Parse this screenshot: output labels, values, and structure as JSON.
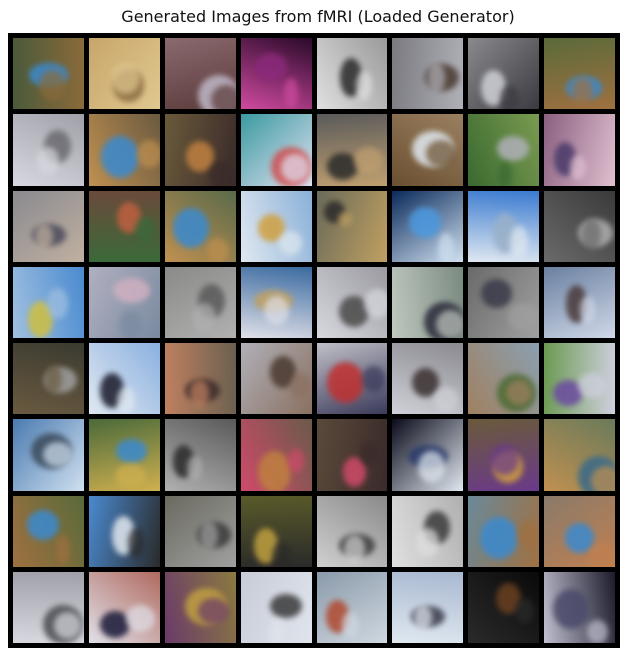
{
  "figure": {
    "title": "Generated Images from fMRI (Loaded Generator)"
  },
  "grid": {
    "rows": 8,
    "cols": 8,
    "frame_color": "#000000",
    "tiles": [
      {
        "base": "#4a5a3a",
        "accent": "#3a8ad0",
        "accent2": "#8a6a3a"
      },
      {
        "base": "#c8a66a",
        "accent": "#8a6a40",
        "accent2": "#e0c890"
      },
      {
        "base": "#8a6a6e",
        "accent": "#c0b8c8",
        "accent2": "#5a3a3a"
      },
      {
        "base": "#2a0a2a",
        "accent": "#8a2a7a",
        "accent2": "#d04aa0"
      },
      {
        "base": "#9a9a9a",
        "accent": "#2a2a2a",
        "accent2": "#e0e0e0"
      },
      {
        "base": "#7a7a80",
        "accent": "#4a3a30",
        "accent2": "#b0b0b8"
      },
      {
        "base": "#8a8a8e",
        "accent": "#d0d0d8",
        "accent2": "#3a3a40"
      },
      {
        "base": "#5a6a3a",
        "accent": "#3a8ad0",
        "accent2": "#a07040"
      },
      {
        "base": "#a0a0a8",
        "accent": "#6a6a70",
        "accent2": "#d8d8e0"
      },
      {
        "base": "#6a5a40",
        "accent": "#3a8ad0",
        "accent2": "#c09050"
      },
      {
        "base": "#6a5a3a",
        "accent": "#c08040",
        "accent2": "#3a2a2a"
      },
      {
        "base": "#3a9aa0",
        "accent": "#d05050",
        "accent2": "#e0e0f0"
      },
      {
        "base": "#5a5a5a",
        "accent": "#2a2a2a",
        "accent2": "#c0a070"
      },
      {
        "base": "#9a8060",
        "accent": "#e0e8f0",
        "accent2": "#6a5030"
      },
      {
        "base": "#7a9a50",
        "accent": "#b0b0b8",
        "accent2": "#3a6a30"
      },
      {
        "base": "#8a6080",
        "accent": "#4a3a6a",
        "accent2": "#e0c0d0"
      },
      {
        "base": "#8a8a90",
        "accent": "#4a4a5a",
        "accent2": "#c0b0a0"
      },
      {
        "base": "#6a4a3a",
        "accent": "#c06040",
        "accent2": "#3a6a3a"
      },
      {
        "base": "#5a6a4a",
        "accent": "#3a8ad0",
        "accent2": "#c09050"
      },
      {
        "base": "#8ab0d8",
        "accent": "#d0a040",
        "accent2": "#e0e8f0"
      },
      {
        "base": "#6a6a5a",
        "accent": "#2a2a2a",
        "accent2": "#c0a060"
      },
      {
        "base": "#0a2a5a",
        "accent": "#4a9ae0",
        "accent2": "#d0e0f0"
      },
      {
        "base": "#3a7ad0",
        "accent": "#9ab0c8",
        "accent2": "#e0e8f0"
      },
      {
        "base": "#3a3a3a",
        "accent": "#b0b0b0",
        "accent2": "#6a6a6a"
      },
      {
        "base": "#4a8ad0",
        "accent": "#d0c040",
        "accent2": "#a0c0e0"
      },
      {
        "base": "#b0b0c0",
        "accent": "#d0b0c0",
        "accent2": "#7a8aa0"
      },
      {
        "base": "#8a8a88",
        "accent": "#5a5a5a",
        "accent2": "#b0b0b0"
      },
      {
        "base": "#3a6aa0",
        "accent": "#c0a060",
        "accent2": "#e0e0e8"
      },
      {
        "base": "#9a9aa0",
        "accent": "#4a4a4a",
        "accent2": "#d8d8e0"
      },
      {
        "base": "#7a8a80",
        "accent": "#2a2a3a",
        "accent2": "#c0c8c0"
      },
      {
        "base": "#6a6a6a",
        "accent": "#3a3a4a",
        "accent2": "#a0a0a0"
      },
      {
        "base": "#6a80a0",
        "accent": "#4a3a3a",
        "accent2": "#d0d8e8"
      },
      {
        "base": "#3a3a30",
        "accent": "#a0a0a0",
        "accent2": "#6a5a40"
      },
      {
        "base": "#8ab0e0",
        "accent": "#1a1a2a",
        "accent2": "#e0e8f0"
      },
      {
        "base": "#6a6050",
        "accent": "#3a2a2a",
        "accent2": "#c08060"
      },
      {
        "base": "#b0b0b8",
        "accent": "#4a3a30",
        "accent2": "#8a7060"
      },
      {
        "base": "#c0c0c8",
        "accent": "#c03030",
        "accent2": "#3a3a5a"
      },
      {
        "base": "#8a8a90",
        "accent": "#3a3030",
        "accent2": "#d0d0d8"
      },
      {
        "base": "#8aa0b0",
        "accent": "#4a6a30",
        "accent2": "#a08060"
      },
      {
        "base": "#6a9a50",
        "accent": "#6a4aa0",
        "accent2": "#d0d0e0"
      },
      {
        "base": "#4a7ab0",
        "accent": "#3a4a5a",
        "accent2": "#d0e0f0"
      },
      {
        "base": "#4a6a3a",
        "accent": "#3a8ad0",
        "accent2": "#d0b050"
      },
      {
        "base": "#5a5a5a",
        "accent": "#2a2a2a",
        "accent2": "#b0b0b0"
      },
      {
        "base": "#6a5a4a",
        "accent": "#c08040",
        "accent2": "#d04a6a"
      },
      {
        "base": "#5a4a3a",
        "accent": "#d04a6a",
        "accent2": "#3a2a2a"
      },
      {
        "base": "#0a0a1a",
        "accent": "#2a3a6a",
        "accent2": "#e0e8f0"
      },
      {
        "base": "#6a5a3a",
        "accent": "#d0a040",
        "accent2": "#6a3a8a"
      },
      {
        "base": "#6a7a5a",
        "accent": "#3a6a8a",
        "accent2": "#c09050"
      },
      {
        "base": "#5a6a3a",
        "accent": "#3a8ad0",
        "accent2": "#a07040"
      },
      {
        "base": "#4a8ad0",
        "accent": "#e0e8f0",
        "accent2": "#2a2a2a"
      },
      {
        "base": "#6a6a60",
        "accent": "#3a3a3a",
        "accent2": "#a0a0a0"
      },
      {
        "base": "#5a5a2a",
        "accent": "#c0a040",
        "accent2": "#2a2a2a"
      },
      {
        "base": "#8a8a8a",
        "accent": "#3a3a3a",
        "accent2": "#d0d0d0"
      },
      {
        "base": "#b0b0b0",
        "accent": "#3a3a3a",
        "accent2": "#e0e0e0"
      },
      {
        "base": "#6a8a9a",
        "accent": "#3a8ad0",
        "accent2": "#a07040"
      },
      {
        "base": "#8a7a6a",
        "accent": "#3a8ad0",
        "accent2": "#c08050"
      },
      {
        "base": "#a0a0a8",
        "accent": "#4a4a50",
        "accent2": "#d8d8e0"
      },
      {
        "base": "#b06a60",
        "accent": "#1a1a3a",
        "accent2": "#e0e0e8"
      },
      {
        "base": "#8a7a40",
        "accent": "#c0a040",
        "accent2": "#6a3a6a"
      },
      {
        "base": "#c8ccd8",
        "accent": "#3a3a3a",
        "accent2": "#e0e4ec"
      },
      {
        "base": "#8a9aaa",
        "accent": "#b04a30",
        "accent2": "#d0d8e0"
      },
      {
        "base": "#a8b8d0",
        "accent": "#3a3a4a",
        "accent2": "#e0e8f0"
      },
      {
        "base": "#0a0a0a",
        "accent": "#6a4020",
        "accent2": "#2a2a2a"
      },
      {
        "base": "#1a1a2a",
        "accent": "#4a4a6a",
        "accent2": "#c0c0d0"
      }
    ]
  }
}
